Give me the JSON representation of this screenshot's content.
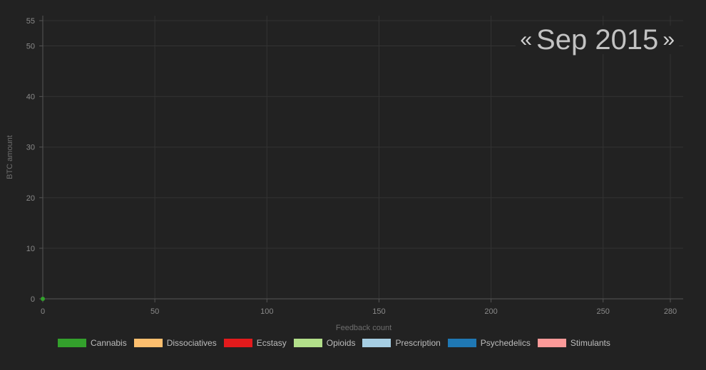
{
  "period": {
    "prev": "«",
    "label": "Sep 2015",
    "next": "»"
  },
  "chart_data": {
    "type": "scatter",
    "xlabel": "Feedback count",
    "ylabel": "BTC amount",
    "xlim": [
      0,
      280
    ],
    "ylim": [
      0,
      55
    ],
    "x_ticks": [
      0,
      50,
      100,
      150,
      200,
      250,
      280
    ],
    "y_ticks": [
      0,
      10,
      20,
      30,
      40,
      50,
      55
    ],
    "grid": true,
    "legend_position": "bottom",
    "series": [
      {
        "name": "Cannabis",
        "color": "#33a02c",
        "points": [
          [
            0,
            0
          ]
        ]
      },
      {
        "name": "Dissociatives",
        "color": "#fdbf6f",
        "points": []
      },
      {
        "name": "Ecstasy",
        "color": "#e31a1c",
        "points": []
      },
      {
        "name": "Opioids",
        "color": "#b2df8a",
        "points": []
      },
      {
        "name": "Prescription",
        "color": "#a6cee3",
        "points": []
      },
      {
        "name": "Psychedelics",
        "color": "#1f78b4",
        "points": []
      },
      {
        "name": "Stimulants",
        "color": "#fb9a99",
        "points": []
      }
    ]
  }
}
